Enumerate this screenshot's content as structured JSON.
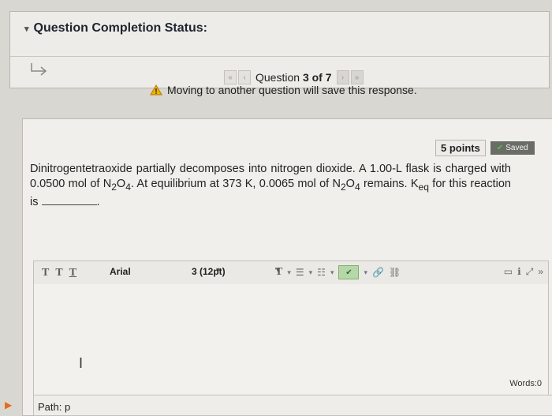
{
  "status": {
    "heading": "Question Completion Status:"
  },
  "navigation": {
    "question_prefix": "Question",
    "question_current": "3 of 7",
    "first_icon": "«",
    "prev_icon": "‹",
    "next_icon": "›",
    "last_icon": "»",
    "warning": "Moving to another question will save this response."
  },
  "question": {
    "points": "5 points",
    "saved": "Saved",
    "text_parts": [
      "Dinitrogentetraoxide partially decomposes into nitrogen dioxide. A 1.00-L flask is charged with 0.0500 mol of N",
      "2",
      "O",
      "4",
      ". At equilibrium at 373 K, 0.0065 mol of N",
      "2",
      "O",
      "4",
      " remains. K",
      "eq",
      " for this reaction is",
      "."
    ]
  },
  "editor": {
    "format_t1": "T",
    "format_t2": "T",
    "format_t3": "T",
    "font": "Arial",
    "size": "3 (12pt)",
    "color_t": "T",
    "words": "Words:0",
    "path": "Path: p"
  }
}
